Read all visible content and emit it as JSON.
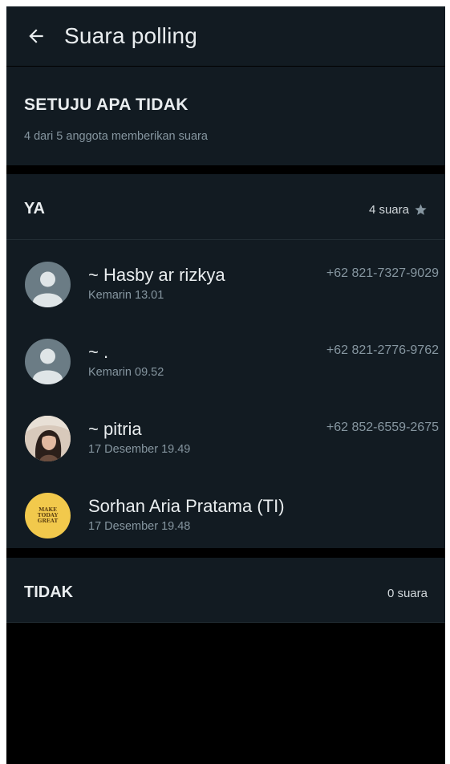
{
  "header": {
    "title": "Suara polling",
    "back_icon": "arrow-left-icon"
  },
  "poll": {
    "question": "SETUJU APA TIDAK",
    "summary": "4 dari 5 anggota memberikan suara"
  },
  "options": [
    {
      "label": "YA",
      "count_label": "4 suara",
      "winner_icon": "star-icon",
      "voters": [
        {
          "name": "~ Hasby ar rizkya",
          "time": "Kemarin 13.01",
          "phone": "+62 821-7327-9029",
          "avatar": "default-person-icon"
        },
        {
          "name": "~ .",
          "time": "Kemarin 09.52",
          "phone": "+62 821-2776-9762",
          "avatar": "default-person-icon"
        },
        {
          "name": "~ pitria",
          "time": "17 Desember 19.49",
          "phone": "+62 852-6559-2675",
          "avatar": "photo"
        },
        {
          "name": "Sorhan Aria Pratama (TI)",
          "time": "17 Desember 19.48",
          "phone": "",
          "avatar": "make-today-great-badge",
          "avatar_text": "MAKE TODAY GREAT"
        }
      ]
    },
    {
      "label": "TIDAK",
      "count_label": "0 suara",
      "voters": []
    }
  ],
  "colors": {
    "background": "#000000",
    "panel": "#121b22",
    "primary_text": "#e9edef",
    "secondary_text": "#8696a0",
    "star": "#8696a0"
  }
}
